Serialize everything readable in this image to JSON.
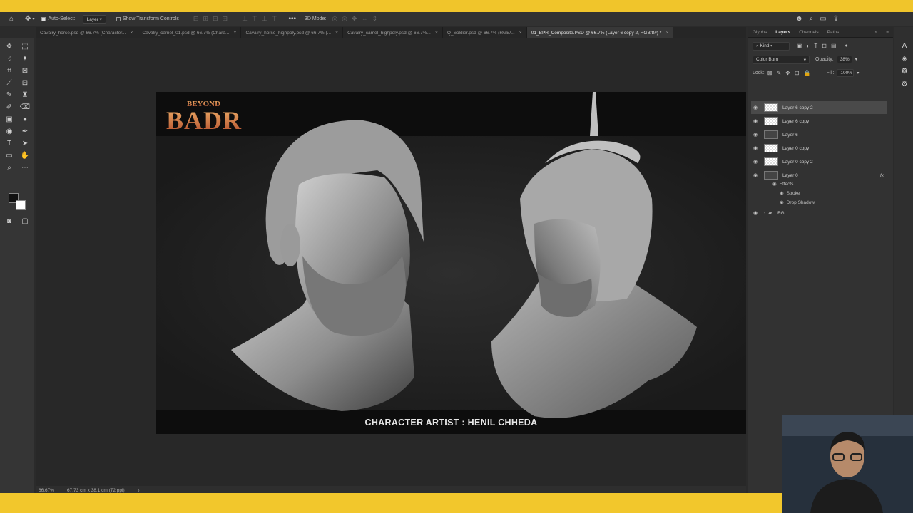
{
  "options_bar": {
    "auto_select_label": "Auto-Select:",
    "auto_select_target": "Layer",
    "show_transform_label": "Show Transform Controls",
    "mode_3d_label": "3D Mode:"
  },
  "tabs": [
    {
      "label": "Cavalry_horse.psd @ 66.7% (Character...",
      "active": false
    },
    {
      "label": "Cavalry_camel_01.psd @ 66.7% (Chara...",
      "active": false
    },
    {
      "label": "Cavalry_horse_highpoly.psd @ 66.7% (...",
      "active": false
    },
    {
      "label": "Cavalry_camel_highpoly.psd @ 66.7%...",
      "active": false
    },
    {
      "label": "Q_Soldier.psd @ 66.7% (RGB/...",
      "active": false
    },
    {
      "label": "01_BPR_Composite.PSD @ 66.7% (Layer 6 copy 2, RGB/8#) *",
      "active": true
    }
  ],
  "canvas": {
    "logo_top": "BEYOND",
    "logo_main": "BADR",
    "credit": "CHARACTER ARTIST : HENIL CHHEDA"
  },
  "status_bar": {
    "zoom": "66.67%",
    "doc_size": "67.73 cm x 38.1 cm (72 ppi)"
  },
  "layers_panel": {
    "tabs": [
      "Glyphs",
      "Layers",
      "Channels",
      "Paths"
    ],
    "active_tab": "Layers",
    "filter_kind": "Kind",
    "blend_mode": "Color Burn",
    "opacity_label": "Opacity:",
    "opacity_value": "38%",
    "lock_label": "Lock:",
    "fill_label": "Fill:",
    "fill_value": "100%",
    "layers": [
      {
        "name": "Layer 6 copy 2",
        "selected": true
      },
      {
        "name": "Layer 6 copy",
        "selected": false
      },
      {
        "name": "Layer 6",
        "selected": false
      },
      {
        "name": "Layer 0 copy",
        "selected": false
      },
      {
        "name": "Layer 0 copy 2",
        "selected": false
      },
      {
        "name": "Layer 0",
        "selected": false,
        "fx": "fx"
      }
    ],
    "effects_label": "Effects",
    "effects": [
      "Stroke",
      "Drop Shadow"
    ],
    "group_name": "BG"
  }
}
